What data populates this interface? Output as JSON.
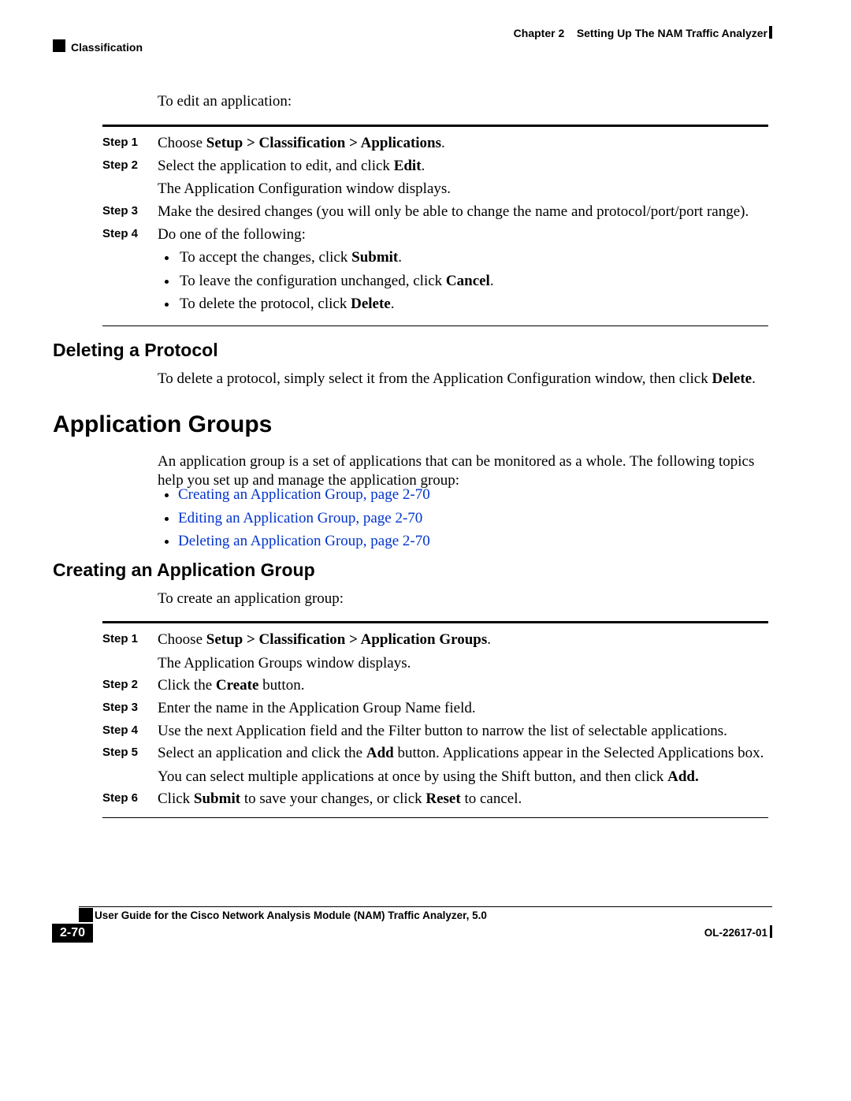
{
  "header": {
    "chapter_label": "Chapter 2",
    "chapter_title": "Setting Up The NAM Traffic Analyzer",
    "section": "Classification"
  },
  "intro_edit": "To edit an application:",
  "steps_edit": [
    {
      "label": "Step 1",
      "html": "Choose <b>Setup > Classification > Applications</b>."
    },
    {
      "label": "Step 2",
      "html": "Select the application to edit, and click <b>Edit</b>.",
      "sub": "The Application Configuration window displays."
    },
    {
      "label": "Step 3",
      "html": "Make the desired changes (you will only be able to change the name and protocol/port/port range)."
    },
    {
      "label": "Step 4",
      "html": "Do one of the following:",
      "bullets": [
        "To accept the changes, click <b>Submit</b>.",
        "To leave the configuration unchanged, click <b>Cancel</b>.",
        "To delete the protocol, click <b>Delete</b>."
      ]
    }
  ],
  "h2_deleting": "Deleting a Protocol",
  "deleting_text_html": "To delete a protocol, simply select it from the Application Configuration window, then click <b>Delete</b>.",
  "h1_appgroups": "Application Groups",
  "appgroups_intro": "An application group is a set of applications that can be monitored as a whole. The following topics help you set up and manage the application group:",
  "appgroups_links": [
    "Creating an Application Group, page 2-70",
    "Editing an Application Group, page 2-70",
    "Deleting an Application Group, page 2-70"
  ],
  "h2_creating": "Creating an Application Group",
  "creating_intro": "To create an application group:",
  "steps_create": [
    {
      "label": "Step 1",
      "html": "Choose <b>Setup > Classification > Application Groups</b>.",
      "sub": "The Application Groups window displays."
    },
    {
      "label": "Step 2",
      "html": "Click the <b>Create</b> button."
    },
    {
      "label": "Step 3",
      "html": "Enter the name in the Application Group Name field."
    },
    {
      "label": "Step 4",
      "html": "Use the next Application field and the Filter button to narrow the list of selectable applications."
    },
    {
      "label": "Step 5",
      "html": "Select an application and click the <b>Add</b> button. Applications appear in the Selected Applications box.",
      "sub_html": "You can select multiple applications at once by using the Shift button, and then click <b>Add.</b>"
    },
    {
      "label": "Step 6",
      "html": "Click <b>Submit</b> to save your changes, or click <b>Reset</b> to cancel."
    }
  ],
  "footer": {
    "guide_title": "User Guide for the Cisco Network Analysis Module (NAM) Traffic Analyzer, 5.0",
    "page_number": "2-70",
    "doc_id": "OL-22617-01"
  }
}
